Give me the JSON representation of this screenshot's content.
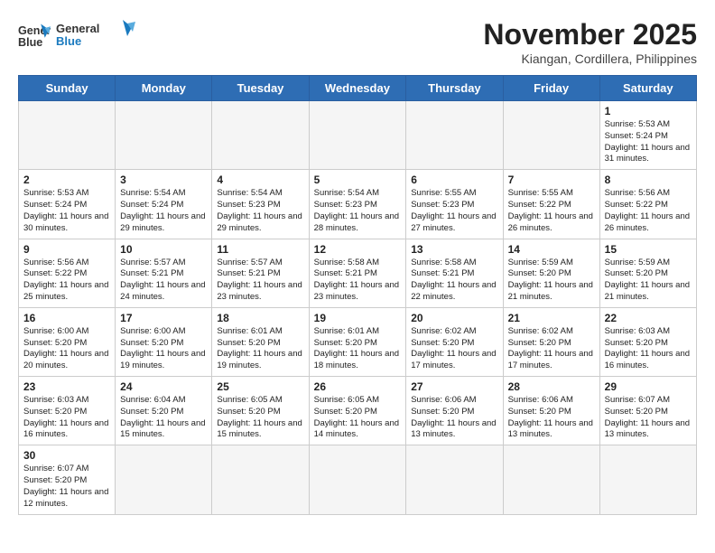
{
  "header": {
    "logo_line1": "General",
    "logo_line2": "Blue",
    "month_title": "November 2025",
    "location": "Kiangan, Cordillera, Philippines"
  },
  "weekdays": [
    "Sunday",
    "Monday",
    "Tuesday",
    "Wednesday",
    "Thursday",
    "Friday",
    "Saturday"
  ],
  "days": {
    "day1": {
      "num": "1",
      "sunrise": "5:53 AM",
      "sunset": "5:24 PM",
      "daylight": "11 hours and 31 minutes."
    },
    "day2": {
      "num": "2",
      "sunrise": "5:53 AM",
      "sunset": "5:24 PM",
      "daylight": "11 hours and 30 minutes."
    },
    "day3": {
      "num": "3",
      "sunrise": "5:54 AM",
      "sunset": "5:24 PM",
      "daylight": "11 hours and 29 minutes."
    },
    "day4": {
      "num": "4",
      "sunrise": "5:54 AM",
      "sunset": "5:23 PM",
      "daylight": "11 hours and 29 minutes."
    },
    "day5": {
      "num": "5",
      "sunrise": "5:54 AM",
      "sunset": "5:23 PM",
      "daylight": "11 hours and 28 minutes."
    },
    "day6": {
      "num": "6",
      "sunrise": "5:55 AM",
      "sunset": "5:23 PM",
      "daylight": "11 hours and 27 minutes."
    },
    "day7": {
      "num": "7",
      "sunrise": "5:55 AM",
      "sunset": "5:22 PM",
      "daylight": "11 hours and 26 minutes."
    },
    "day8": {
      "num": "8",
      "sunrise": "5:56 AM",
      "sunset": "5:22 PM",
      "daylight": "11 hours and 26 minutes."
    },
    "day9": {
      "num": "9",
      "sunrise": "5:56 AM",
      "sunset": "5:22 PM",
      "daylight": "11 hours and 25 minutes."
    },
    "day10": {
      "num": "10",
      "sunrise": "5:57 AM",
      "sunset": "5:21 PM",
      "daylight": "11 hours and 24 minutes."
    },
    "day11": {
      "num": "11",
      "sunrise": "5:57 AM",
      "sunset": "5:21 PM",
      "daylight": "11 hours and 23 minutes."
    },
    "day12": {
      "num": "12",
      "sunrise": "5:58 AM",
      "sunset": "5:21 PM",
      "daylight": "11 hours and 23 minutes."
    },
    "day13": {
      "num": "13",
      "sunrise": "5:58 AM",
      "sunset": "5:21 PM",
      "daylight": "11 hours and 22 minutes."
    },
    "day14": {
      "num": "14",
      "sunrise": "5:59 AM",
      "sunset": "5:20 PM",
      "daylight": "11 hours and 21 minutes."
    },
    "day15": {
      "num": "15",
      "sunrise": "5:59 AM",
      "sunset": "5:20 PM",
      "daylight": "11 hours and 21 minutes."
    },
    "day16": {
      "num": "16",
      "sunrise": "6:00 AM",
      "sunset": "5:20 PM",
      "daylight": "11 hours and 20 minutes."
    },
    "day17": {
      "num": "17",
      "sunrise": "6:00 AM",
      "sunset": "5:20 PM",
      "daylight": "11 hours and 19 minutes."
    },
    "day18": {
      "num": "18",
      "sunrise": "6:01 AM",
      "sunset": "5:20 PM",
      "daylight": "11 hours and 19 minutes."
    },
    "day19": {
      "num": "19",
      "sunrise": "6:01 AM",
      "sunset": "5:20 PM",
      "daylight": "11 hours and 18 minutes."
    },
    "day20": {
      "num": "20",
      "sunrise": "6:02 AM",
      "sunset": "5:20 PM",
      "daylight": "11 hours and 17 minutes."
    },
    "day21": {
      "num": "21",
      "sunrise": "6:02 AM",
      "sunset": "5:20 PM",
      "daylight": "11 hours and 17 minutes."
    },
    "day22": {
      "num": "22",
      "sunrise": "6:03 AM",
      "sunset": "5:20 PM",
      "daylight": "11 hours and 16 minutes."
    },
    "day23": {
      "num": "23",
      "sunrise": "6:03 AM",
      "sunset": "5:20 PM",
      "daylight": "11 hours and 16 minutes."
    },
    "day24": {
      "num": "24",
      "sunrise": "6:04 AM",
      "sunset": "5:20 PM",
      "daylight": "11 hours and 15 minutes."
    },
    "day25": {
      "num": "25",
      "sunrise": "6:05 AM",
      "sunset": "5:20 PM",
      "daylight": "11 hours and 15 minutes."
    },
    "day26": {
      "num": "26",
      "sunrise": "6:05 AM",
      "sunset": "5:20 PM",
      "daylight": "11 hours and 14 minutes."
    },
    "day27": {
      "num": "27",
      "sunrise": "6:06 AM",
      "sunset": "5:20 PM",
      "daylight": "11 hours and 13 minutes."
    },
    "day28": {
      "num": "28",
      "sunrise": "6:06 AM",
      "sunset": "5:20 PM",
      "daylight": "11 hours and 13 minutes."
    },
    "day29": {
      "num": "29",
      "sunrise": "6:07 AM",
      "sunset": "5:20 PM",
      "daylight": "11 hours and 13 minutes."
    },
    "day30": {
      "num": "30",
      "sunrise": "6:07 AM",
      "sunset": "5:20 PM",
      "daylight": "11 hours and 12 minutes."
    }
  }
}
